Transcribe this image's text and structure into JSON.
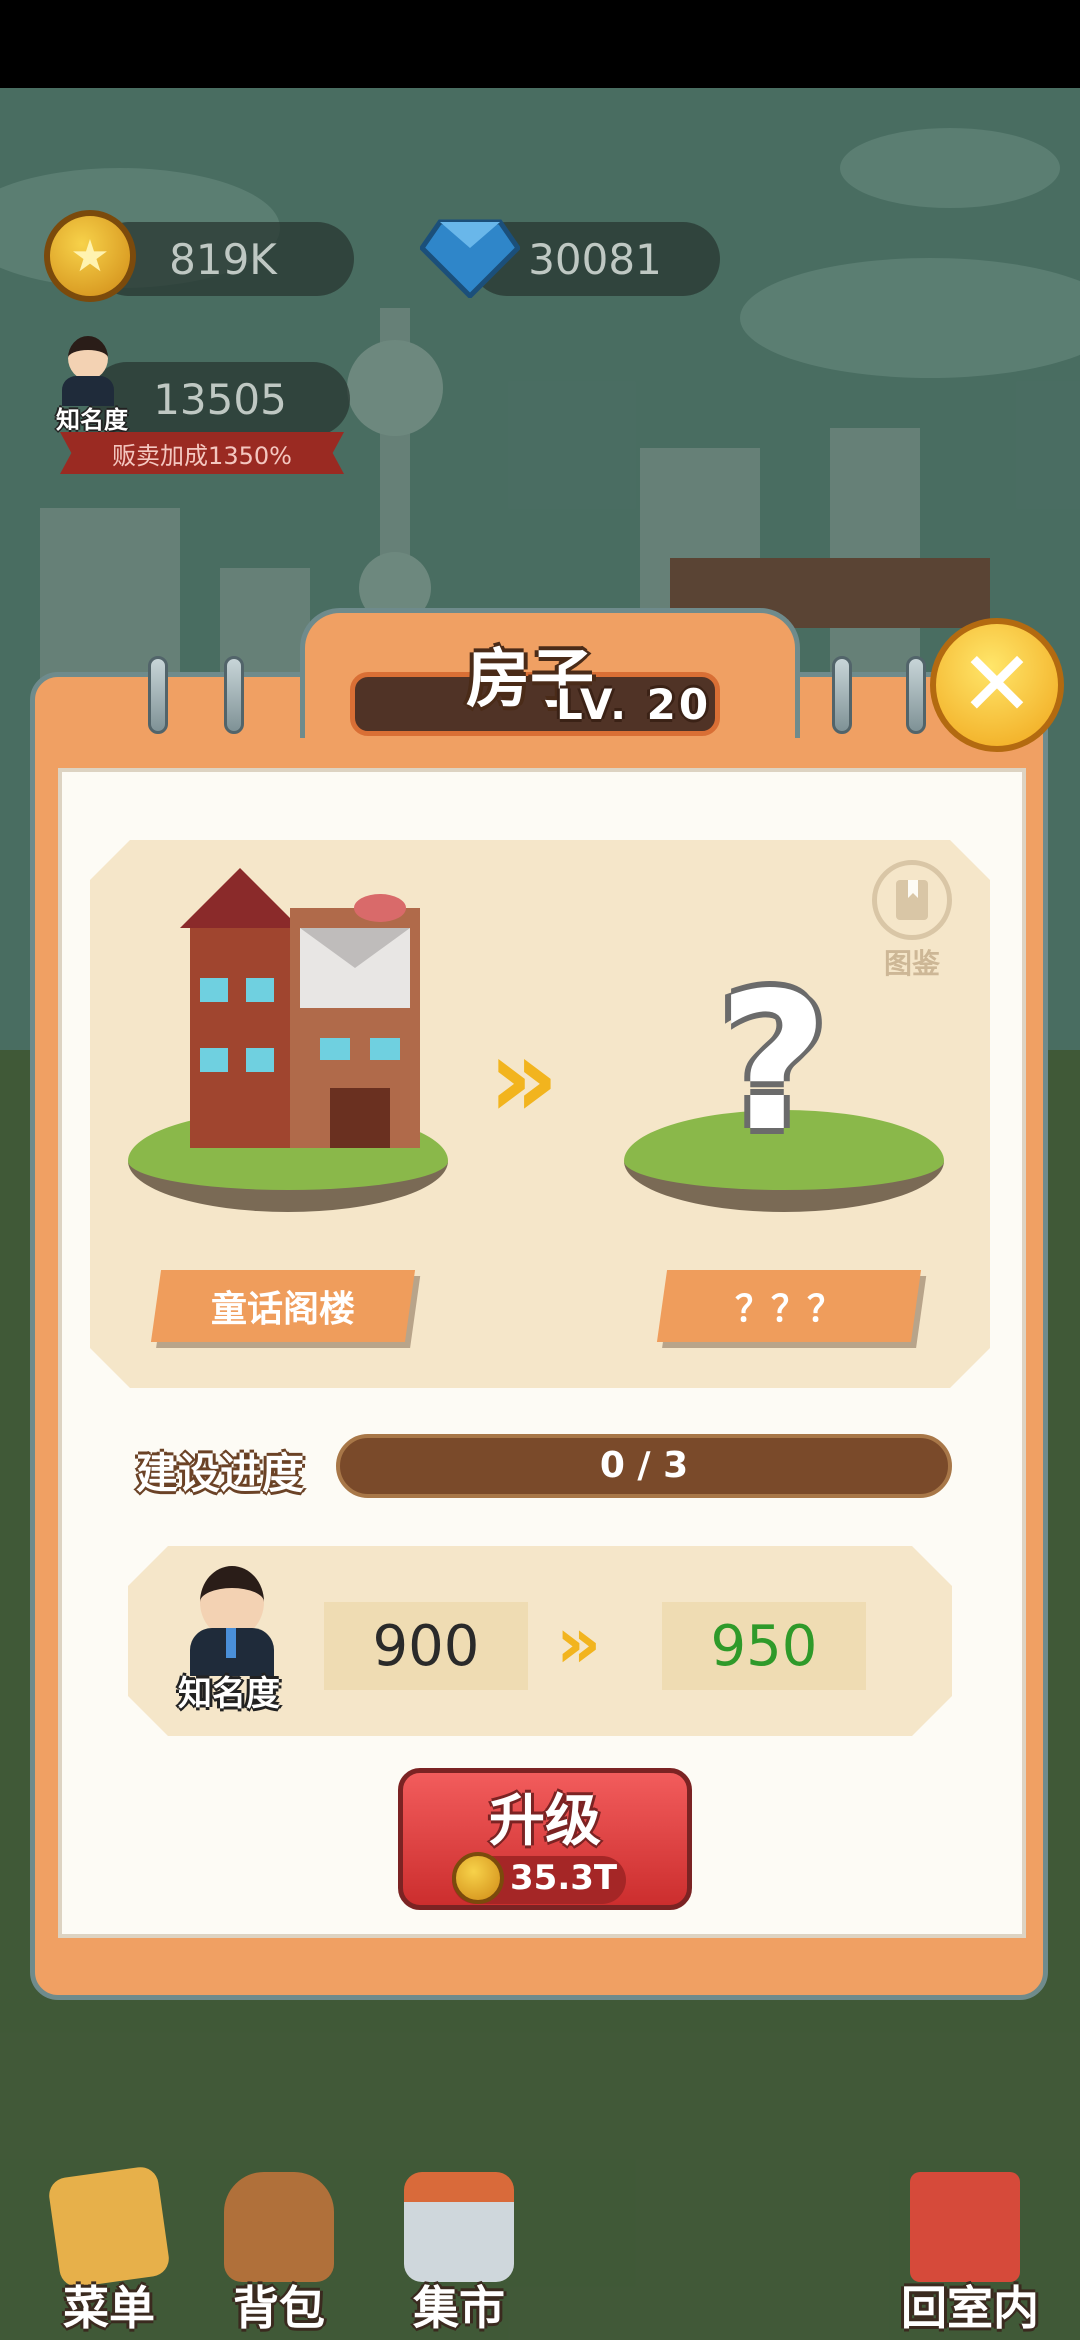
{
  "hud": {
    "coins": "819K",
    "gems": "30081",
    "reputation": "13505",
    "reputation_label": "知名度",
    "sell_bonus": "贩卖加成1350%"
  },
  "panel": {
    "title": "房子",
    "level": "LV. 20",
    "close": "✕",
    "atlas_label": "图鉴",
    "current_building": "童话阁楼",
    "next_building": "？？？",
    "unknown_mark": "?",
    "progress_label": "建设进度",
    "progress_current": 0,
    "progress_total": 3,
    "progress_text": "0 / 3",
    "reputation_label": "知名度",
    "reputation_from": "900",
    "reputation_to": "950",
    "upgrade_label": "升级",
    "upgrade_cost": "35.3T"
  },
  "nav": {
    "menu": "菜单",
    "bag": "背包",
    "market": "集市",
    "home": "回室内"
  },
  "colors": {
    "panel_orange": "#f0a063",
    "upgrade_red": "#cc2e2e",
    "increase_green": "#2f9a2a",
    "progress_brown": "#7a4a2a"
  }
}
